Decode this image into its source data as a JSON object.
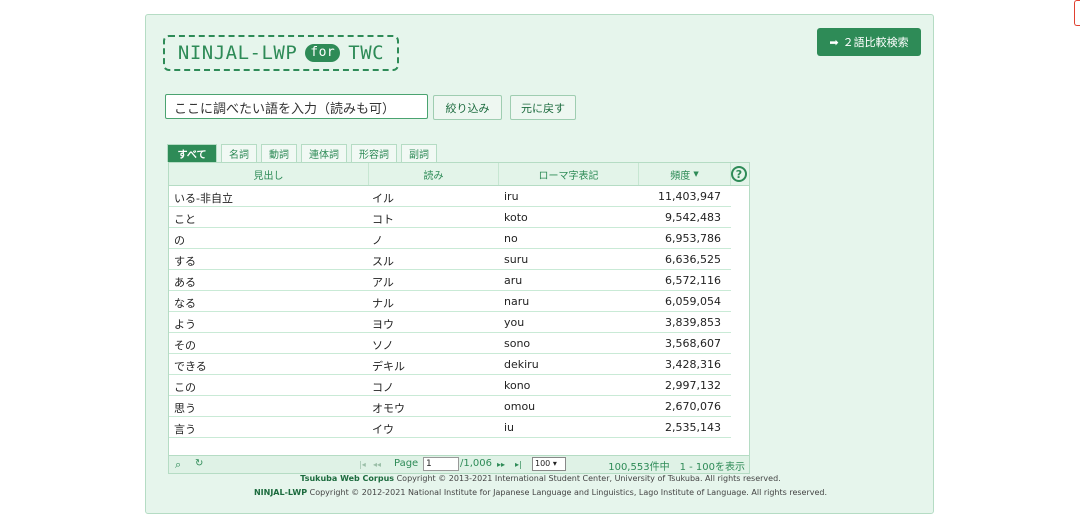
{
  "header": {
    "logo_main": "NINJAL-LWP",
    "logo_for": "for",
    "logo_twc": "TWC",
    "compare_button": "２語比較検索",
    "compare_icon": "arrow-right-icon"
  },
  "search": {
    "placeholder": "ここに調べたい語を入力（読みも可）",
    "filter_label": "絞り込み",
    "reset_label": "元に戻す"
  },
  "tabs": [
    {
      "label": "すべて",
      "active": true
    },
    {
      "label": "名詞",
      "active": false
    },
    {
      "label": "動詞",
      "active": false
    },
    {
      "label": "連体詞",
      "active": false
    },
    {
      "label": "形容詞",
      "active": false
    },
    {
      "label": "副詞",
      "active": false
    }
  ],
  "grid": {
    "columns": [
      "見出し",
      "読み",
      "ローマ字表記",
      "頻度"
    ],
    "sort_indicator": "▼",
    "help_icon": "question-circle-icon",
    "rows": [
      {
        "headword": "いる-非自立",
        "reading": "イル",
        "romaji": "iru",
        "freq": "11,403,947"
      },
      {
        "headword": "こと",
        "reading": "コト",
        "romaji": "koto",
        "freq": "9,542,483"
      },
      {
        "headword": "の",
        "reading": "ノ",
        "romaji": "no",
        "freq": "6,953,786"
      },
      {
        "headword": "する",
        "reading": "スル",
        "romaji": "suru",
        "freq": "6,636,525"
      },
      {
        "headword": "ある",
        "reading": "アル",
        "romaji": "aru",
        "freq": "6,572,116"
      },
      {
        "headword": "なる",
        "reading": "ナル",
        "romaji": "naru",
        "freq": "6,059,054"
      },
      {
        "headword": "よう",
        "reading": "ヨウ",
        "romaji": "you",
        "freq": "3,839,853"
      },
      {
        "headword": "その",
        "reading": "ソノ",
        "romaji": "sono",
        "freq": "3,568,607"
      },
      {
        "headword": "できる",
        "reading": "デキル",
        "romaji": "dekiru",
        "freq": "3,428,316"
      },
      {
        "headword": "この",
        "reading": "コノ",
        "romaji": "kono",
        "freq": "2,997,132"
      },
      {
        "headword": "思う",
        "reading": "オモウ",
        "romaji": "omou",
        "freq": "2,670,076"
      },
      {
        "headword": "言う",
        "reading": "イウ",
        "romaji": "iu",
        "freq": "2,535,143"
      }
    ]
  },
  "pager": {
    "search_icon": "magnifier-icon",
    "refresh_icon": "refresh-icon",
    "first_icon": "first-page-icon",
    "prev_icon": "prev-page-icon",
    "next_icon": "next-page-icon",
    "last_icon": "last-page-icon",
    "page_label": "Page",
    "page_value": "1",
    "page_total": "/1,006",
    "per_page": "100",
    "summary": "100,553件中　1 - 100を表示"
  },
  "footer": {
    "line1_brand": "Tsukuba Web Corpus",
    "line1_text": " Copyright © 2013-2021 International Student Center, University of Tsukuba. All rights reserved.",
    "line2_brand": "NINJAL-LWP",
    "line2_text": " Copyright © 2012-2021 National Institute for Japanese Language and Linguistics, Lago Institute of Language. All rights reserved."
  },
  "colors": {
    "accent": "#2e8b57",
    "panel_bg": "#e6f5ec"
  }
}
